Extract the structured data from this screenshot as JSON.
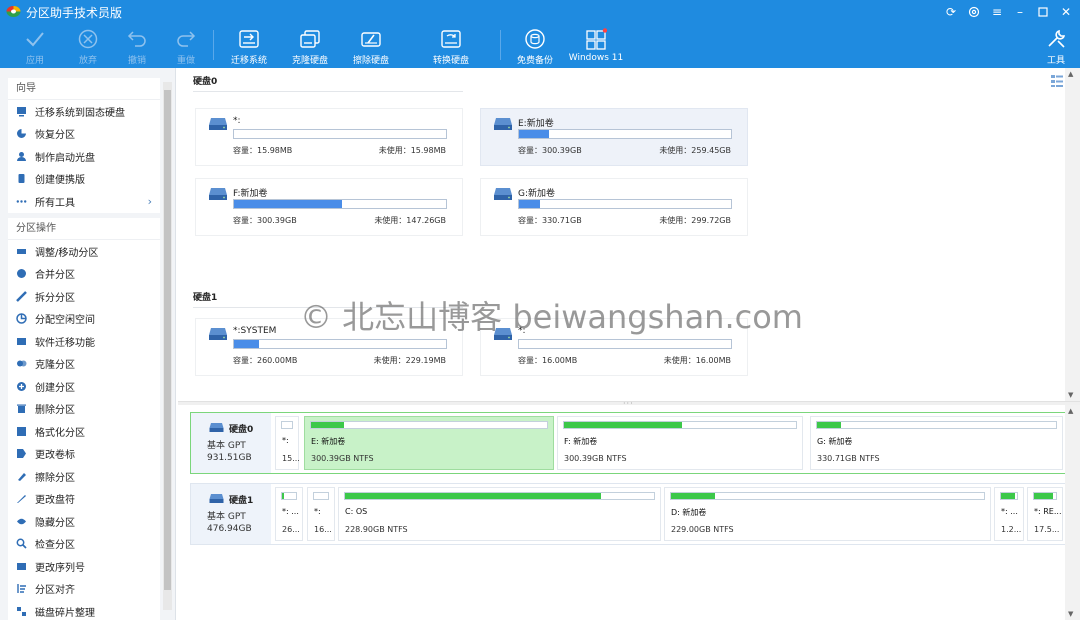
{
  "window": {
    "title": "分区助手技术员版"
  },
  "toolbar": {
    "items": [
      {
        "label": "应用",
        "icon": "check-icon"
      },
      {
        "label": "放弃",
        "icon": "discard-icon"
      },
      {
        "label": "撤销",
        "icon": "undo-icon"
      },
      {
        "label": "重做",
        "icon": "redo-icon"
      },
      {
        "label": "迁移系统",
        "icon": "migrate-os-icon"
      },
      {
        "label": "克隆硬盘",
        "icon": "clone-disk-icon"
      },
      {
        "label": "擦除硬盘",
        "icon": "wipe-disk-icon"
      },
      {
        "label": "转换硬盘",
        "icon": "convert-disk-icon"
      },
      {
        "label": "免费备份",
        "icon": "backup-icon"
      },
      {
        "label": "Windows 11",
        "icon": "windows11-icon"
      },
      {
        "label": "工具",
        "icon": "tools-icon"
      }
    ]
  },
  "sidebar": {
    "wizard_title": "向导",
    "wizard_items": [
      {
        "label": "迁移系统到固态硬盘",
        "icon": "migrate-icon"
      },
      {
        "label": "恢复分区",
        "icon": "recover-icon"
      },
      {
        "label": "制作启动光盘",
        "icon": "boot-disc-icon"
      },
      {
        "label": "创建便携版",
        "icon": "portable-icon"
      },
      {
        "label": "所有工具",
        "icon": "more-icon"
      }
    ],
    "ops_title": "分区操作",
    "ops_items": [
      {
        "label": "调整/移动分区",
        "icon": "resize-icon"
      },
      {
        "label": "合并分区",
        "icon": "merge-icon"
      },
      {
        "label": "拆分分区",
        "icon": "split-icon"
      },
      {
        "label": "分配空闲空间",
        "icon": "allocate-icon"
      },
      {
        "label": "软件迁移功能",
        "icon": "app-mover-icon"
      },
      {
        "label": "克隆分区",
        "icon": "clone-icon"
      },
      {
        "label": "创建分区",
        "icon": "create-icon"
      },
      {
        "label": "删除分区",
        "icon": "delete-icon"
      },
      {
        "label": "格式化分区",
        "icon": "format-icon"
      },
      {
        "label": "更改卷标",
        "icon": "label-icon"
      },
      {
        "label": "擦除分区",
        "icon": "wipe-icon"
      },
      {
        "label": "更改盘符",
        "icon": "letter-icon"
      },
      {
        "label": "隐藏分区",
        "icon": "hide-icon"
      },
      {
        "label": "检查分区",
        "icon": "check-partition-icon"
      },
      {
        "label": "更改序列号",
        "icon": "serial-icon"
      },
      {
        "label": "分区对齐",
        "icon": "align-icon"
      },
      {
        "label": "磁盘碎片整理",
        "icon": "defrag-icon"
      }
    ]
  },
  "upper": {
    "disks": [
      {
        "title": "硬盘0",
        "volumes": [
          {
            "name": "*:",
            "used_fraction": 0.0,
            "capacity": "容量：15.98MB",
            "free": "未使用：15.98MB",
            "selected": false
          },
          {
            "name": "E:新加卷",
            "used_fraction": 0.14,
            "capacity": "容量：300.39GB",
            "free": "未使用：259.45GB",
            "selected": true
          },
          {
            "name": "F:新加卷",
            "used_fraction": 0.51,
            "capacity": "容量：300.39GB",
            "free": "未使用：147.26GB",
            "selected": false
          },
          {
            "name": "G:新加卷",
            "used_fraction": 0.1,
            "capacity": "容量：330.71GB",
            "free": "未使用：299.72GB",
            "selected": false
          }
        ]
      },
      {
        "title": "硬盘1",
        "volumes": [
          {
            "name": "*:SYSTEM",
            "used_fraction": 0.12,
            "capacity": "容量：260.00MB",
            "free": "未使用：229.19MB",
            "selected": false
          },
          {
            "name": "*:",
            "used_fraction": 0.0,
            "capacity": "容量：16.00MB",
            "free": "未使用：16.00MB",
            "selected": false
          }
        ]
      }
    ]
  },
  "lower": {
    "disks": [
      {
        "name": "硬盘0",
        "type": "基本 GPT",
        "size": "931.51GB",
        "selected": true,
        "partitions": [
          {
            "name": "*:",
            "info": "15...",
            "used_fraction": 0.0,
            "selected": false
          },
          {
            "name": "E: 新加卷",
            "info": "300.39GB NTFS",
            "used_fraction": 0.14,
            "selected": true
          },
          {
            "name": "F: 新加卷",
            "info": "300.39GB NTFS",
            "used_fraction": 0.51,
            "selected": false
          },
          {
            "name": "G: 新加卷",
            "info": "330.71GB NTFS",
            "used_fraction": 0.1,
            "selected": false
          }
        ]
      },
      {
        "name": "硬盘1",
        "type": "基本 GPT",
        "size": "476.94GB",
        "selected": false,
        "partitions": [
          {
            "name": "*: ...",
            "info": "26...",
            "used_fraction": 0.15,
            "selected": false
          },
          {
            "name": "*:",
            "info": "16...",
            "used_fraction": 0.0,
            "selected": false
          },
          {
            "name": "C: OS",
            "info": "228.90GB NTFS",
            "used_fraction": 0.83,
            "selected": false
          },
          {
            "name": "D: 新加卷",
            "info": "229.00GB NTFS",
            "used_fraction": 0.14,
            "selected": false
          },
          {
            "name": "*: ...",
            "info": "1.2...",
            "used_fraction": 0.9,
            "selected": false
          },
          {
            "name": "*: RE...",
            "info": "17.5...",
            "used_fraction": 0.85,
            "selected": false
          }
        ]
      }
    ]
  },
  "watermark": "© 北忘山博客 beiwangshan.com",
  "colors": {
    "accent": "#1f8be0",
    "bar_blue": "#4a8de8",
    "bar_green": "#3cc84a",
    "selected_green": "#c8f2c8"
  }
}
